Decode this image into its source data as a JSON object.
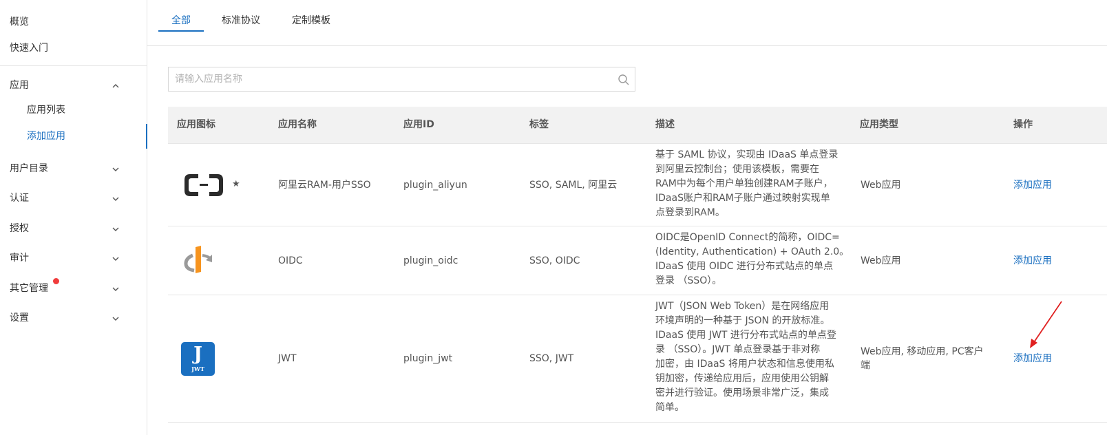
{
  "sidebar": {
    "items": [
      {
        "label": "概览"
      },
      {
        "label": "快速入门"
      },
      {
        "label": "应用"
      },
      {
        "label": "应用列表"
      },
      {
        "label": "添加应用"
      },
      {
        "label": "用户目录"
      },
      {
        "label": "认证"
      },
      {
        "label": "授权"
      },
      {
        "label": "审计"
      },
      {
        "label": "其它管理"
      },
      {
        "label": "设置"
      }
    ]
  },
  "tabs": [
    {
      "label": "全部"
    },
    {
      "label": "标准协议"
    },
    {
      "label": "定制模板"
    }
  ],
  "search": {
    "placeholder": "请输入应用名称",
    "value": ""
  },
  "table": {
    "headers": [
      "应用图标",
      "应用名称",
      "应用ID",
      "标签",
      "描述",
      "应用类型",
      "操作"
    ],
    "rows": [
      {
        "name": "阿里云RAM-用户SSO",
        "id": "plugin_aliyun",
        "tags": "SSO, SAML, 阿里云",
        "desc": [
          "基于 SAML 协议，实现由 IDaaS 单点登录",
          "到阿里云控制台；使用该模板，需要在",
          "RAM中为每个用户单独创建RAM子账户，",
          "IDaaS账户和RAM子账户通过映射实现单",
          "点登录到RAM。"
        ],
        "type": [
          "Web应用"
        ],
        "action": "添加应用",
        "icon": "aliyun-logo-icon",
        "star": "★"
      },
      {
        "name": "OIDC",
        "id": "plugin_oidc",
        "tags": "SSO, OIDC",
        "desc": [
          "OIDC是OpenID Connect的简称，OIDC=",
          "(Identity, Authentication) + OAuth 2.0。",
          "IDaaS 使用 OIDC 进行分布式站点的单点",
          "登录 （SSO）。"
        ],
        "type": [
          "Web应用"
        ],
        "action": "添加应用",
        "icon": "openid-logo-icon"
      },
      {
        "name": "JWT",
        "id": "plugin_jwt",
        "tags": "SSO, JWT",
        "desc": [
          "JWT（JSON Web Token）是在网络应用",
          "环境声明的一种基于 JSON 的开放标准。",
          "IDaaS 使用 JWT 进行分布式站点的单点登",
          "录 （SSO）。JWT 单点登录基于非对称",
          "加密，由 IDaaS 将用户状态和信息使用私",
          "钥加密，传递给应用后，应用使用公钥解",
          "密并进行验证。使用场景非常广泛，集成",
          "简单。"
        ],
        "type": [
          "Web应用, 移动应用, PC客户",
          "端"
        ],
        "action": "添加应用",
        "icon": "jwt-logo-icon",
        "icon_text": "J",
        "icon_subtext": "JWT"
      }
    ]
  },
  "colors": {
    "accent": "#1a6fc0",
    "badge": "#f03b3b",
    "arrow": "#e02020"
  }
}
